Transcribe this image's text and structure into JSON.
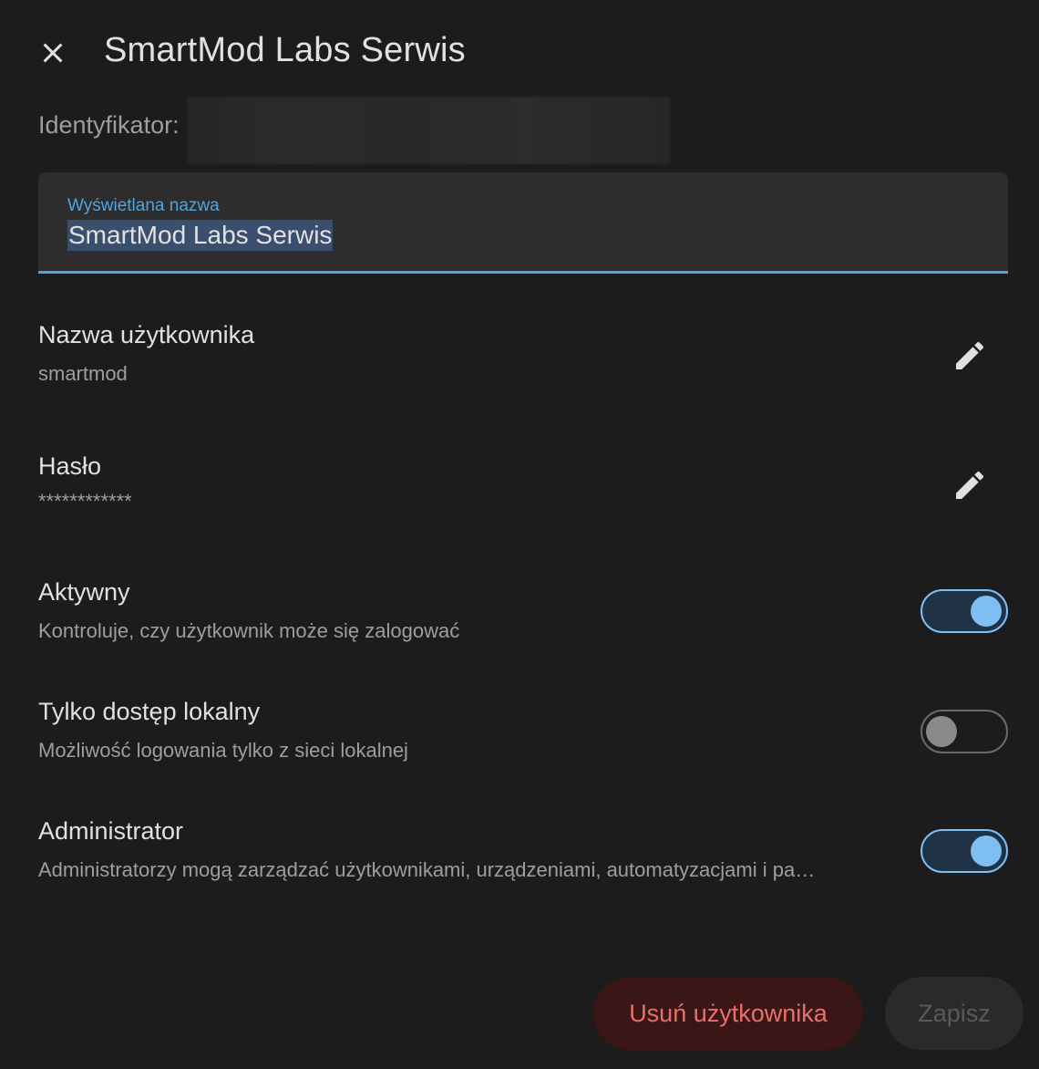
{
  "dialog": {
    "title": "SmartMod Labs Serwis",
    "id_label": "Identyfikator:"
  },
  "display_name_field": {
    "label": "Wyświetlana nazwa",
    "value": "SmartMod Labs Serwis"
  },
  "username": {
    "title": "Nazwa użytkownika",
    "value": "smartmod"
  },
  "password": {
    "title": "Hasło",
    "value": "************"
  },
  "toggles": [
    {
      "title": "Aktywny",
      "description": "Kontroluje, czy użytkownik może się zalogować",
      "checked": true
    },
    {
      "title": "Tylko dostęp lokalny",
      "description": "Możliwość logowania tylko z sieci lokalnej",
      "checked": false
    },
    {
      "title": "Administrator",
      "description": "Administratorzy mogą zarządzać użytkownikami, urządzeniami, automatyzacjami i pa…",
      "checked": true
    }
  ],
  "actions": {
    "delete_label": "Usuń użytkownika",
    "save_label": "Zapisz"
  },
  "colors": {
    "accent": "#4fa3e0",
    "switch_on": "#7fbef2",
    "danger": "#e8706a",
    "background": "#1c1c1c"
  },
  "icons": {
    "close": "close-icon",
    "edit": "pencil-icon"
  }
}
